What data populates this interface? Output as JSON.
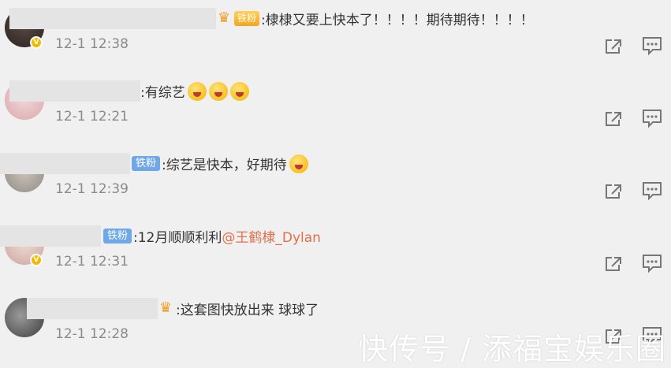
{
  "comments": [
    {
      "badge": "铁粉",
      "badge_type": "gold",
      "text": ":棣棣又要上快本了！！！！期待期待！！！！",
      "time": "12-1 12:38",
      "emoji_count": 0,
      "verified": true
    },
    {
      "badge": "",
      "badge_type": "none",
      "text": ":有综艺",
      "time": "12-1 12:21",
      "emoji_count": 3,
      "verified": false
    },
    {
      "badge": "铁粉",
      "badge_type": "blue",
      "text": ":综艺是快本，好期待",
      "time": "12-1 12:39",
      "emoji_count": 1,
      "verified": false
    },
    {
      "badge": "铁粉",
      "badge_type": "blue",
      "text": ":12月顺顺利利",
      "mention": "@王鹤棣_Dylan",
      "time": "12-1 12:31",
      "emoji_count": 0,
      "verified": true
    },
    {
      "badge": "",
      "badge_type": "crown",
      "text": ":这套图快放出来 球球了",
      "time": "12-1 12:28",
      "emoji_count": 0,
      "verified": false
    }
  ],
  "icons": {
    "share": "share-icon",
    "reply": "reply-icon",
    "verified": "verified-badge-icon"
  },
  "watermark": "快传号 / 添福宝娱乐圈",
  "colors": {
    "background": "#f0f0f0",
    "fan_badge": "#6fa8e8",
    "mention": "#e46d4b",
    "time": "#8a8a8a"
  }
}
